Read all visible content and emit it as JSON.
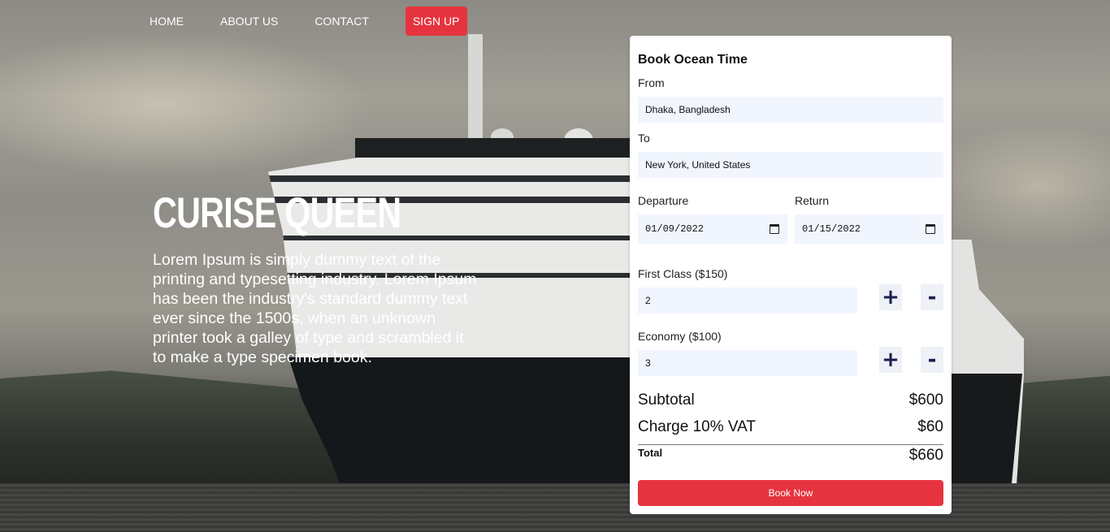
{
  "nav": {
    "home": "HOME",
    "about": "ABOUT US",
    "contact": "CONTACT",
    "signup": "SIGN UP"
  },
  "hero": {
    "title": "CURISE QUEEN",
    "text": "Lorem Ipsum is simply dummy text of the printing and typesetting industry. Lorem Ipsum has been the industry's standard dummy text ever since the 1500s, when an unknown printer took a galley of type and scrambled it to make a type specimen book."
  },
  "booking": {
    "title": "Book Ocean Time",
    "from_label": "From",
    "from_value": "Dhaka, Bangladesh",
    "to_label": "To",
    "to_value": "New York, United States",
    "departure_label": "Departure",
    "departure_value": "01/09/2022",
    "return_label": "Return",
    "return_value": "01/15/2022",
    "first_class_label": "First Class ($150)",
    "first_class_value": "2",
    "economy_label": "Economy ($100)",
    "economy_value": "3",
    "plus": "+",
    "minus": "-",
    "subtotal_label": "Subtotal",
    "subtotal_value": "$600",
    "vat_label": "Charge 10% VAT",
    "vat_value": "$60",
    "total_label": "Total",
    "total_value": "$660",
    "book_now": "Book Now"
  },
  "colors": {
    "accent": "#e5343f",
    "field_bg": "#f1f5fe",
    "stepper_text": "#1c1f4e"
  }
}
